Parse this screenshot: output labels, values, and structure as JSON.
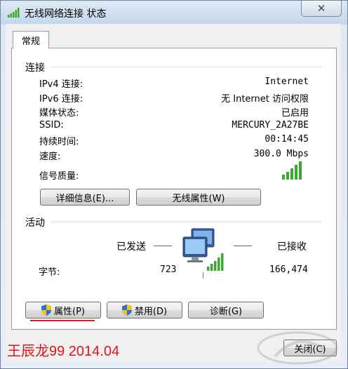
{
  "window": {
    "title": "无线网络连接 状态",
    "close_glyph": "✕"
  },
  "tabs": [
    {
      "label": "常规"
    }
  ],
  "connection": {
    "header": "连接",
    "rows": [
      {
        "label": "IPv4 连接:",
        "value": "Internet"
      },
      {
        "label": "IPv6 连接:",
        "value": "无 Internet 访问权限"
      },
      {
        "label": "媒体状态:",
        "value": "已启用"
      },
      {
        "label": "SSID:",
        "value": "MERCURY_2A27BE"
      },
      {
        "label": "持续时间:",
        "value": "00:14:45"
      },
      {
        "label": "速度:",
        "value": "300.0 Mbps"
      },
      {
        "label": "信号质量:",
        "value": ""
      }
    ],
    "signal_bars": 5,
    "details_button": "详细信息(E)...",
    "wireless_props_button": "无线属性(W)"
  },
  "activity": {
    "header": "活动",
    "sent_label": "已发送",
    "received_label": "已接收",
    "bytes_label": "字节:",
    "bytes_sent": "723",
    "bytes_received": "166,474"
  },
  "buttons": {
    "properties": "属性(P)",
    "disable": "禁用(D)",
    "diagnose": "诊断(G)",
    "close": "关闭(C)"
  },
  "watermark": {
    "text": "王辰龙99 2014.04",
    "color": "#e0141c"
  },
  "colors": {
    "accent_red": "#e21b1b",
    "signal_green": "#3aa833"
  }
}
